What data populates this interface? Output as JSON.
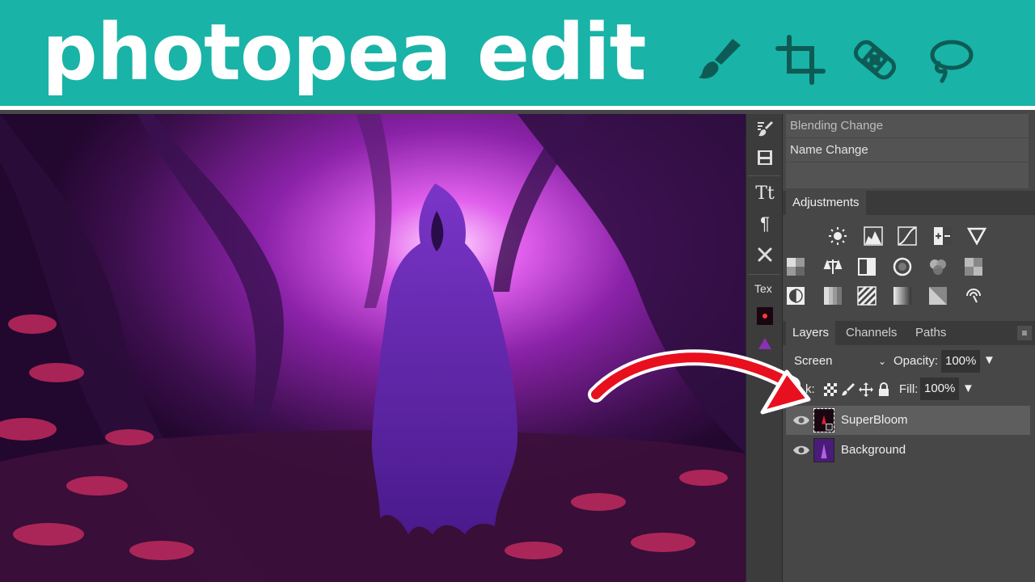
{
  "banner": {
    "title": "photopea edit",
    "icons": [
      "brush-icon",
      "crop-icon",
      "bandage-icon",
      "lasso-icon"
    ]
  },
  "canvas": {
    "description_icon": "hooded-figure-forest-image"
  },
  "toolstrip": {
    "text_label": "Tex"
  },
  "history": {
    "items": [
      {
        "label": "Blending Change"
      },
      {
        "label": "Name Change"
      }
    ]
  },
  "adjustments": {
    "tab_label": "Adjustments"
  },
  "layers_panel": {
    "tabs": [
      {
        "label": "Layers"
      },
      {
        "label": "Channels"
      },
      {
        "label": "Paths"
      }
    ],
    "blend_mode": "Screen",
    "opacity_label": "Opacity:",
    "opacity_value": "100%",
    "lock_label": "k:",
    "fill_label": "Fill:",
    "fill_value": "100%",
    "layers": [
      {
        "name": "SuperBloom",
        "selected": true
      },
      {
        "name": "Background",
        "selected": false
      }
    ]
  },
  "colors": {
    "banner": "#19b3a7",
    "panel_bg": "#474747",
    "annotation_arrow": "#e8101e"
  }
}
